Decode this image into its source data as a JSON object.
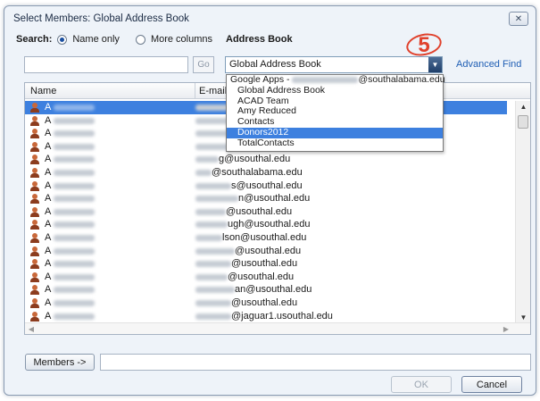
{
  "window": {
    "title": "Select Members: Global Address Book",
    "close_icon": "close-icon"
  },
  "search": {
    "label": "Search:",
    "options": [
      {
        "label": "Name only",
        "checked": true
      },
      {
        "label": "More columns",
        "checked": false
      }
    ],
    "input_value": "",
    "go_label": "Go"
  },
  "address_book": {
    "label": "Address Book",
    "selected": "Global Address Book",
    "advanced_find": "Advanced Find",
    "step_badge": "5",
    "dropdown": [
      {
        "label": "Google Apps - ",
        "suffix": "@southalabama.edu",
        "redacted": true,
        "indent": false,
        "active": false
      },
      {
        "label": "Global Address Book",
        "indent": true,
        "active": false
      },
      {
        "label": "ACAD Team",
        "indent": true,
        "active": false
      },
      {
        "label": "Amy Reduced",
        "indent": true,
        "active": false
      },
      {
        "label": "Contacts",
        "indent": true,
        "active": false
      },
      {
        "label": "Donors2012",
        "indent": true,
        "active": true
      },
      {
        "label": "TotalContacts",
        "indent": true,
        "active": false
      }
    ]
  },
  "list": {
    "columns": [
      "Name",
      "E-mail"
    ],
    "rows": [
      {
        "name": "A",
        "email": "",
        "selected": true
      },
      {
        "name": "A",
        "email": ""
      },
      {
        "name": "A",
        "email": ""
      },
      {
        "name": "A",
        "email": ""
      },
      {
        "name": "A",
        "email": "g@usouthal.edu"
      },
      {
        "name": "A",
        "email": "@southalabama.edu"
      },
      {
        "name": "A",
        "email": "s@usouthal.edu"
      },
      {
        "name": "A",
        "email": "n@usouthal.edu"
      },
      {
        "name": "A",
        "email": "@usouthal.edu"
      },
      {
        "name": "A",
        "email": "ugh@usouthal.edu"
      },
      {
        "name": "A",
        "email": "lson@usouthal.edu"
      },
      {
        "name": "A",
        "email": "@usouthal.edu"
      },
      {
        "name": "A",
        "email": "@usouthal.edu"
      },
      {
        "name": "A",
        "email": "@usouthal.edu"
      },
      {
        "name": "A",
        "email": "an@usouthal.edu"
      },
      {
        "name": "A",
        "email": "@usouthal.edu"
      },
      {
        "name": "A",
        "email": "@jaguar1.usouthal.edu"
      }
    ]
  },
  "footer": {
    "members_label": "Members ->",
    "members_value": "",
    "ok_label": "OK",
    "cancel_label": "Cancel"
  }
}
